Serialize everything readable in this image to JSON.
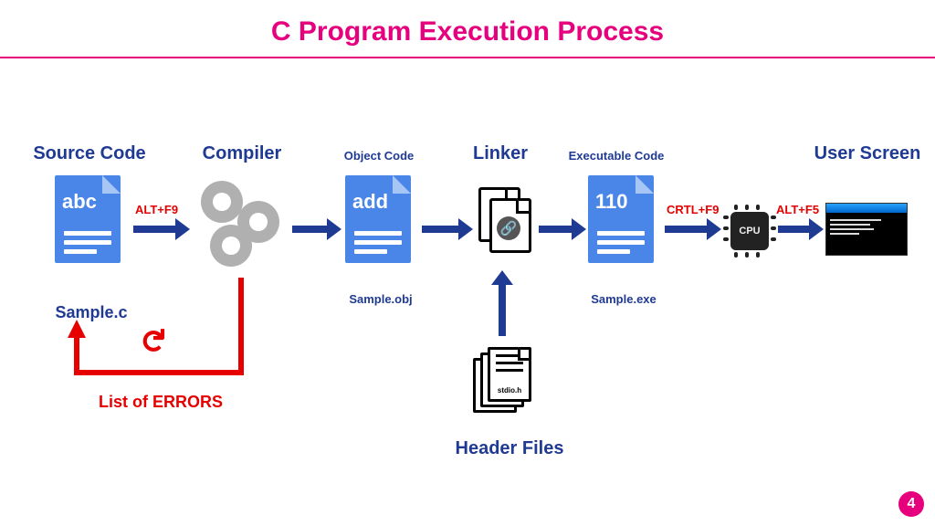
{
  "title": "C Program Execution Process",
  "page_number": "4",
  "stages": {
    "source": {
      "heading": "Source Code",
      "icon_text": "abc",
      "filename": "Sample.c"
    },
    "compiler": {
      "heading": "Compiler"
    },
    "object": {
      "heading": "Object Code",
      "icon_text": "add",
      "filename": "Sample.obj"
    },
    "linker": {
      "heading": "Linker"
    },
    "exe": {
      "heading": "Executable Code",
      "icon_text": "110",
      "filename": "Sample.exe"
    },
    "cpu": {
      "chip_label": "CPU"
    },
    "screen": {
      "heading": "User Screen"
    }
  },
  "shortcuts": {
    "compile": "ALT+F9",
    "run": "CRTL+F9",
    "output": "ALT+F5"
  },
  "error_loop": {
    "label": "List of ERRORS"
  },
  "header_files": {
    "heading": "Header Files",
    "example": "stdio.h"
  }
}
